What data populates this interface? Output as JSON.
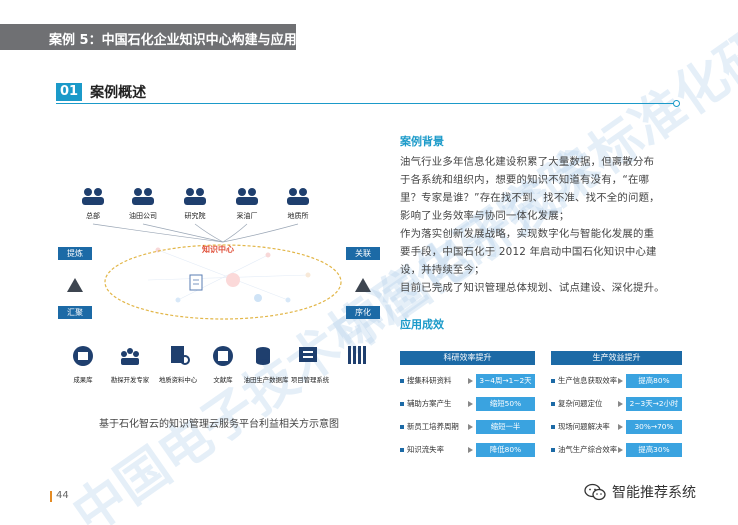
{
  "header": {
    "title": "案例 5：中国石化企业知识中心构建与应用"
  },
  "section": {
    "number": "01",
    "title": "案例概述"
  },
  "diagram": {
    "top_nodes": [
      "总部",
      "油田公司",
      "研究院",
      "采油厂",
      "地质所"
    ],
    "center_label": "知识中心",
    "left_top": "提炼",
    "left_bottom": "汇聚",
    "right_top": "关联",
    "right_bottom": "序化",
    "bottom_items": [
      "成果库",
      "勘探开发专家",
      "地质资料中心",
      "文献库",
      "油田生产数据库",
      "项目管理系统"
    ]
  },
  "caption": "基于石化智云的知识管理云服务平台利益相关方示意图",
  "background": {
    "heading": "案例背景",
    "lines": [
      "油气行业多年信息化建设积累了大量数据，但离散分布",
      "于各系统和组织内，想要的知识不知道有没有，“在哪",
      "里？专家是谁？”存在找不到、找不准、找不全的问题，",
      "影响了业务效率与协同一体化发展；",
      "作为落实创新发展战略，实现数字化与智能化发展的重",
      "要手段，中国石化于 2012 年启动中国石化知识中心建",
      "设，并持续至今；",
      "目前已完成了知识管理总体规划、试点建设、深化提升。"
    ]
  },
  "results": {
    "heading": "应用成效",
    "left_table": {
      "title": "科研效率提升",
      "rows": [
        {
          "label": "搜集科研资料",
          "value": "3~4周→1~2天"
        },
        {
          "label": "辅助方案产生",
          "value": "缩短50%"
        },
        {
          "label": "新员工培养周期",
          "value": "缩短一半"
        },
        {
          "label": "知识流失率",
          "value": "降低80%"
        }
      ]
    },
    "right_table": {
      "title": "生产效益提升",
      "rows": [
        {
          "label": "生产信息获取效率",
          "value": "提高80%"
        },
        {
          "label": "复杂问题定位",
          "value": "2~3天→2小时"
        },
        {
          "label": "现场问题解决率",
          "value": "30%→70%"
        },
        {
          "label": "油气生产综合效率",
          "value": "提高30%"
        }
      ]
    }
  },
  "footer": {
    "page": "44",
    "brand": "智能推荐系统"
  },
  "colors": {
    "accent": "#1b9ac9",
    "header_bg": "#6f7073",
    "table_head": "#1c6aa6",
    "value_bg": "#3aa3e0",
    "page_bar": "#e48b24"
  }
}
